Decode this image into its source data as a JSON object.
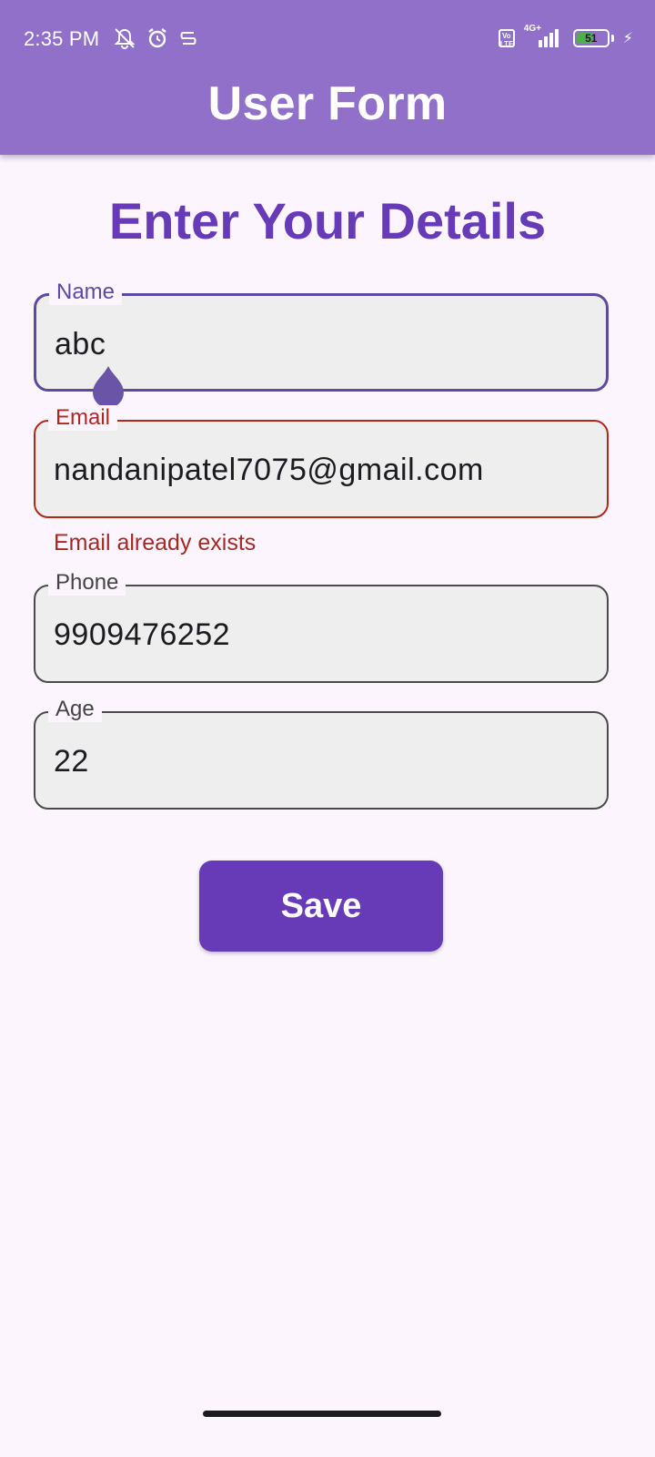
{
  "status_bar": {
    "time": "2:35 PM",
    "volte": "Vo\nLTE",
    "network": "4G+",
    "battery": "51"
  },
  "app_bar": {
    "title": "User Form"
  },
  "form": {
    "heading": "Enter Your Details",
    "fields": [
      {
        "label": "Name",
        "value": "abc",
        "state": "focused"
      },
      {
        "label": "Email",
        "value": "nandanipatel7075@gmail.com",
        "state": "error",
        "error": "Email already exists"
      },
      {
        "label": "Phone",
        "value": "9909476252",
        "state": "normal"
      },
      {
        "label": "Age",
        "value": "22",
        "state": "normal"
      }
    ],
    "save_label": "Save"
  },
  "colors": {
    "app_bar": "#9170c9",
    "primary": "#673ab7",
    "error": "#b3261e",
    "background": "#fcf5fd"
  }
}
